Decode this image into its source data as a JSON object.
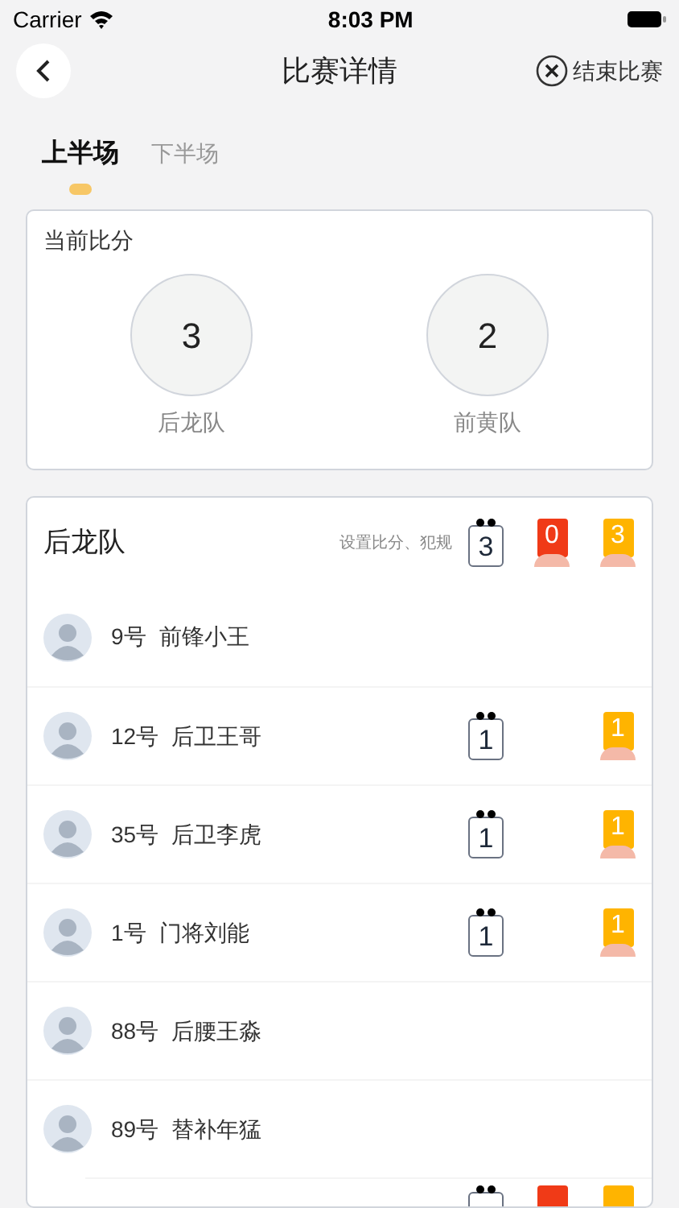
{
  "status_bar": {
    "carrier": "Carrier",
    "time": "8:03 PM"
  },
  "nav": {
    "title": "比赛详情",
    "end_button": "结束比赛"
  },
  "tabs": [
    {
      "label": "上半场",
      "selected": true
    },
    {
      "label": "下半场",
      "selected": false
    }
  ],
  "score_card": {
    "title": "当前比分",
    "teams": [
      {
        "score": "3",
        "name": "后龙队"
      },
      {
        "score": "2",
        "name": "前黄队"
      }
    ]
  },
  "team_card": {
    "name": "后龙队",
    "hint": "设置比分、犯规",
    "goals": "3",
    "red": "0",
    "yellow": "3",
    "players": [
      {
        "kind": "player",
        "number": "9号",
        "name": "前锋小王"
      },
      {
        "kind": "player",
        "number": "12号",
        "name": "后卫王哥",
        "goals": "1",
        "yellow": "1"
      },
      {
        "kind": "player",
        "number": "35号",
        "name": "后卫李虎",
        "goals": "1",
        "yellow": "1"
      },
      {
        "kind": "player",
        "number": "1号",
        "name": "门将刘能",
        "goals": "1",
        "yellow": "1"
      },
      {
        "kind": "player",
        "number": "88号",
        "name": "后腰王淼"
      },
      {
        "kind": "player",
        "number": "89号",
        "name": "替补年猛"
      },
      {
        "kind": "cut"
      }
    ]
  }
}
